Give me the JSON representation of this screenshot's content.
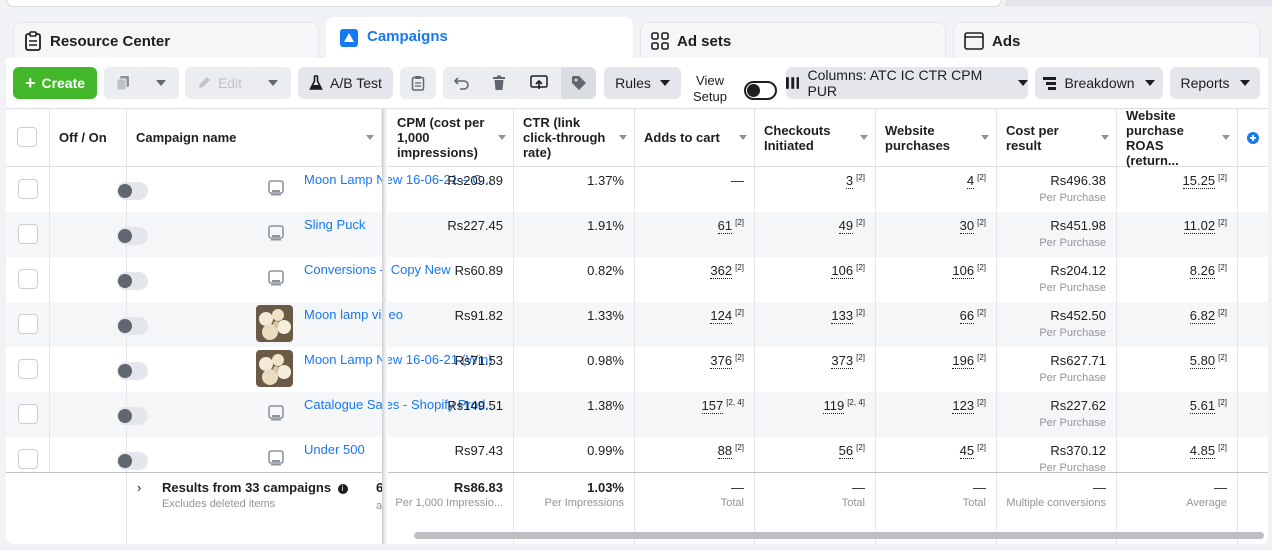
{
  "tabs": {
    "resource_center": "Resource Center",
    "campaigns": "Campaigns",
    "ad_sets": "Ad sets",
    "ads": "Ads"
  },
  "toolbar": {
    "create": "Create",
    "edit": "Edit",
    "ab_test": "A/B Test",
    "rules": "Rules",
    "view_setup": "View Setup",
    "columns": "Columns: ATC IC CTR CPM PUR",
    "breakdown": "Breakdown",
    "reports": "Reports"
  },
  "columns": {
    "off_on": "Off / On",
    "campaign_name": "Campaign name",
    "cpm": "CPM (cost per 1,000 impressions)",
    "ctr": "CTR (link click-through rate)",
    "adds_to_cart": "Adds to cart",
    "checkouts": "Checkouts Initiated",
    "purchases": "Website purchases",
    "cost_per_result": "Cost per result",
    "roas": "Website purchase ROAS (return..."
  },
  "rows": [
    {
      "name": "Moon Lamp New 16-06-21 – C...",
      "cpm": "Rs209.89",
      "ctr": "1.37%",
      "atc": "—",
      "atc_note": "",
      "ci": "3",
      "ci_note": "[2]",
      "pur": "4",
      "pur_note": "[2]",
      "cpr": "Rs496.38",
      "cpr_sub": "Per Purchase",
      "roas": "15.25",
      "roas_note": "[2]"
    },
    {
      "name": "Sling Puck",
      "cpm": "Rs227.45",
      "ctr": "1.91%",
      "atc": "61",
      "atc_note": "[2]",
      "ci": "49",
      "ci_note": "[2]",
      "pur": "30",
      "pur_note": "[2]",
      "cpr": "Rs451.98",
      "cpr_sub": "Per Purchase",
      "roas": "11.02",
      "roas_note": "[2]"
    },
    {
      "name": "Conversions – Copy New",
      "cpm": "Rs60.89",
      "ctr": "0.82%",
      "atc": "362",
      "atc_note": "[2]",
      "ci": "106",
      "ci_note": "[2]",
      "pur": "106",
      "pur_note": "[2]",
      "cpr": "Rs204.12",
      "cpr_sub": "Per Purchase",
      "roas": "8.26",
      "roas_note": "[2]"
    },
    {
      "name": "Moon lamp video",
      "cpm": "Rs91.82",
      "ctr": "1.33%",
      "atc": "124",
      "atc_note": "[2]",
      "ci": "133",
      "ci_note": "[2]",
      "pur": "66",
      "pur_note": "[2]",
      "cpr": "Rs452.50",
      "cpr_sub": "Per Purchase",
      "roas": "6.82",
      "roas_note": "[2]"
    },
    {
      "name": "Moon Lamp New 16-06-21 (Win)",
      "cpm": "Rs71.53",
      "ctr": "0.98%",
      "atc": "376",
      "atc_note": "[2]",
      "ci": "373",
      "ci_note": "[2]",
      "pur": "196",
      "pur_note": "[2]",
      "cpr": "Rs627.71",
      "cpr_sub": "Per Purchase",
      "roas": "5.80",
      "roas_note": "[2]"
    },
    {
      "name": "Catalogue Sales - Shopify Prod...",
      "cpm": "Rs149.51",
      "ctr": "1.38%",
      "atc": "157",
      "atc_note": "[2, 4]",
      "ci": "119",
      "ci_note": "[2, 4]",
      "pur": "123",
      "pur_note": "[2]",
      "cpr": "Rs227.62",
      "cpr_sub": "Per Purchase",
      "roas": "5.61",
      "roas_note": "[2]"
    },
    {
      "name": "Under 500",
      "cpm": "Rs97.43",
      "ctr": "0.99%",
      "atc": "88",
      "atc_note": "[2]",
      "ci": "56",
      "ci_note": "[2]",
      "pur": "45",
      "pur_note": "[2]",
      "cpr": "Rs370.12",
      "cpr_sub": "Per Purchase",
      "roas": "4.85",
      "roas_note": "[2]"
    }
  ],
  "footer": {
    "results": "Results from 33 campaigns",
    "excludes": "Excludes deleted items",
    "clipped_digit": "6",
    "clipped_label": "al",
    "cpm": "Rs86.83",
    "cpm_sub": "Per 1,000 Impressio...",
    "ctr": "1.03%",
    "ctr_sub": "Per Impressions",
    "atc": "—",
    "atc_sub": "Total",
    "ci": "—",
    "ci_sub": "Total",
    "pur": "—",
    "pur_sub": "Total",
    "cpr": "—",
    "cpr_sub": "Multiple conversions",
    "roas": "—",
    "roas_sub": "Average"
  },
  "colors": {
    "accent": "#1877f2",
    "create_green": "#42b72a"
  }
}
